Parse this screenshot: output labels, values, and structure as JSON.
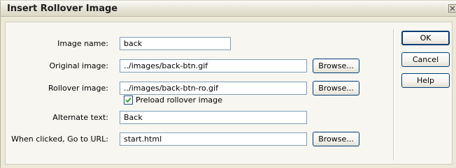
{
  "dialog": {
    "title": "Insert Rollover Image",
    "close_icon": "close-icon"
  },
  "form": {
    "image_name": {
      "label": "Image name:",
      "value": "back"
    },
    "original_image": {
      "label": "Original image:",
      "value": "../images/back-btn.gif",
      "browse": "Browse..."
    },
    "rollover_image": {
      "label": "Rollover image:",
      "value": "../images/back-btn-ro.gif",
      "browse": "Browse..."
    },
    "preload": {
      "label": "Preload rollover image",
      "checked": true
    },
    "alternate_text": {
      "label": "Alternate text:",
      "value": "Back"
    },
    "url": {
      "label": "When clicked, Go to URL:",
      "value": "start.html",
      "browse": "Browse..."
    }
  },
  "buttons": {
    "ok": "OK",
    "cancel": "Cancel",
    "help": "Help"
  }
}
